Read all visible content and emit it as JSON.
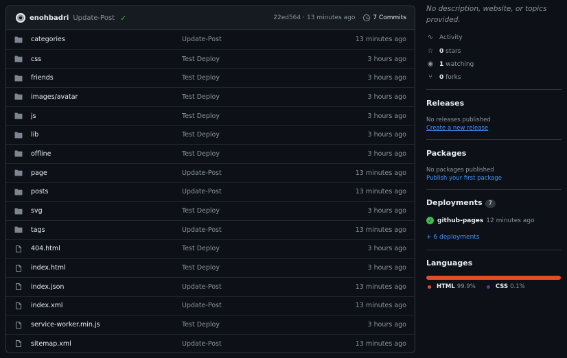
{
  "commit": {
    "author": "enohbadri",
    "message": "Update-Post",
    "hash": "22ed564",
    "age": "13 minutes ago",
    "commits_label": "7 Commits"
  },
  "files": [
    {
      "name": "categories",
      "type": "dir",
      "message": "Update-Post",
      "age": "13 minutes ago"
    },
    {
      "name": "css",
      "type": "dir",
      "message": "Test Deploy",
      "age": "3 hours ago"
    },
    {
      "name": "friends",
      "type": "dir",
      "message": "Test Deploy",
      "age": "3 hours ago"
    },
    {
      "name": "images/avatar",
      "type": "dir",
      "message": "Test Deploy",
      "age": "3 hours ago"
    },
    {
      "name": "js",
      "type": "dir",
      "message": "Test Deploy",
      "age": "3 hours ago"
    },
    {
      "name": "lib",
      "type": "dir",
      "message": "Test Deploy",
      "age": "3 hours ago"
    },
    {
      "name": "offline",
      "type": "dir",
      "message": "Test Deploy",
      "age": "3 hours ago"
    },
    {
      "name": "page",
      "type": "dir",
      "message": "Update-Post",
      "age": "13 minutes ago"
    },
    {
      "name": "posts",
      "type": "dir",
      "message": "Update-Post",
      "age": "13 minutes ago"
    },
    {
      "name": "svg",
      "type": "dir",
      "message": "Test Deploy",
      "age": "3 hours ago"
    },
    {
      "name": "tags",
      "type": "dir",
      "message": "Update-Post",
      "age": "13 minutes ago"
    },
    {
      "name": "404.html",
      "type": "file",
      "message": "Test Deploy",
      "age": "3 hours ago"
    },
    {
      "name": "index.html",
      "type": "file",
      "message": "Test Deploy",
      "age": "3 hours ago"
    },
    {
      "name": "index.json",
      "type": "file",
      "message": "Update-Post",
      "age": "13 minutes ago"
    },
    {
      "name": "index.xml",
      "type": "file",
      "message": "Update-Post",
      "age": "13 minutes ago"
    },
    {
      "name": "service-worker.min.js",
      "type": "file",
      "message": "Test Deploy",
      "age": "3 hours ago"
    },
    {
      "name": "sitemap.xml",
      "type": "file",
      "message": "Update-Post",
      "age": "13 minutes ago"
    }
  ],
  "about": {
    "description": "No description, website, or topics provided.",
    "activity": "Activity",
    "stars_count": "0",
    "stars_label": "stars",
    "watching_count": "1",
    "watching_label": "watching",
    "forks_count": "0",
    "forks_label": "forks"
  },
  "releases": {
    "title": "Releases",
    "empty": "No releases published",
    "create_link": "Create a new release"
  },
  "packages": {
    "title": "Packages",
    "empty": "No packages published",
    "publish_link": "Publish your first package"
  },
  "deployments": {
    "title": "Deployments",
    "count": "7",
    "latest_name": "github-pages",
    "latest_age": "12 minutes ago",
    "more_link": "+ 6 deployments"
  },
  "languages": {
    "title": "Languages",
    "items": [
      {
        "name": "HTML",
        "percent": "99.9%",
        "fraction": 0.999,
        "color": "#e34c26"
      },
      {
        "name": "CSS",
        "percent": "0.1%",
        "fraction": 0.001,
        "color": "#663399"
      }
    ]
  },
  "colors": {
    "background": "#0d1117",
    "border": "#30363d",
    "link": "#4493f8",
    "success": "#3fb950",
    "folder": "#7d8590"
  }
}
